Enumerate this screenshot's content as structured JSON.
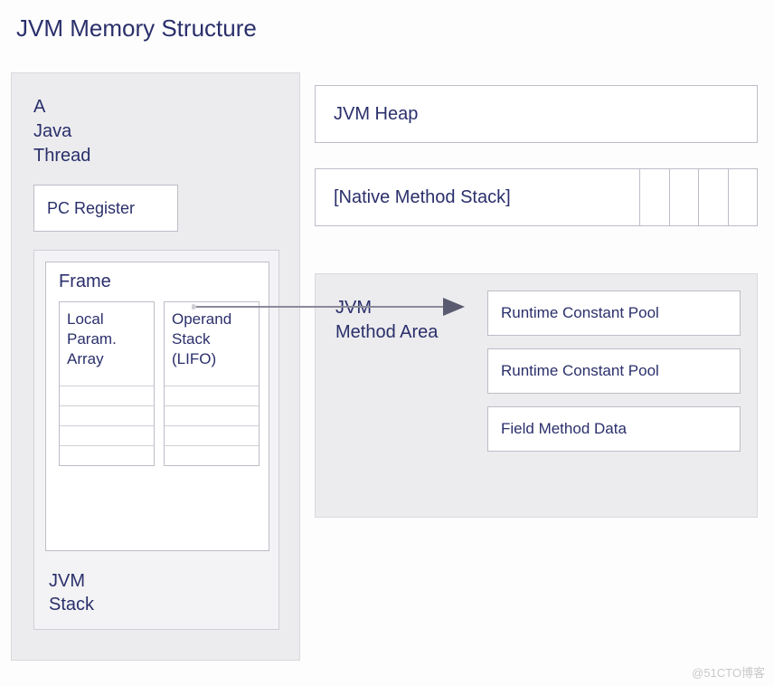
{
  "title": "JVM Memory Structure",
  "thread": {
    "label": "A\nJava\nThread",
    "pc_register": "PC Register",
    "jvm_stack_label": "JVM\nStack",
    "frame": {
      "label": "Frame",
      "local": "Local\nParam.\nArray",
      "operand": "Operand\nStack\n(LIFO)"
    }
  },
  "heap": "JVM Heap",
  "native_stack": "[Native Method Stack]",
  "method_area": {
    "label": "JVM\nMethod Area",
    "items": [
      "Runtime Constant Pool",
      "Runtime Constant Pool",
      "Field Method Data"
    ]
  },
  "watermark": "@51CTO博客"
}
